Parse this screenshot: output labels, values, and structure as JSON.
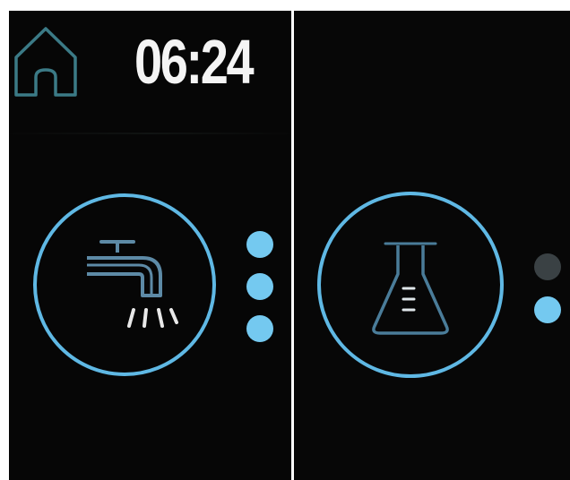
{
  "status_bar": {
    "time": "06:24"
  },
  "icons": {
    "home": "home-icon",
    "faucet": "faucet-icon",
    "flask": "flask-icon"
  },
  "pager_left": {
    "dots": 3,
    "active_indices": [
      0,
      1,
      2
    ]
  },
  "pager_right": {
    "dots": 2,
    "active_indices": [
      1
    ]
  },
  "colors": {
    "background": "#060606",
    "accent": "#5fb8e4",
    "dot_active": "#74c9f0",
    "dot_inactive": "#3a4144",
    "icon_outline": "#4a7c99",
    "home_outline": "#3b7a86",
    "clock_text": "#f4f4f4",
    "bezel": "#ffffff"
  }
}
